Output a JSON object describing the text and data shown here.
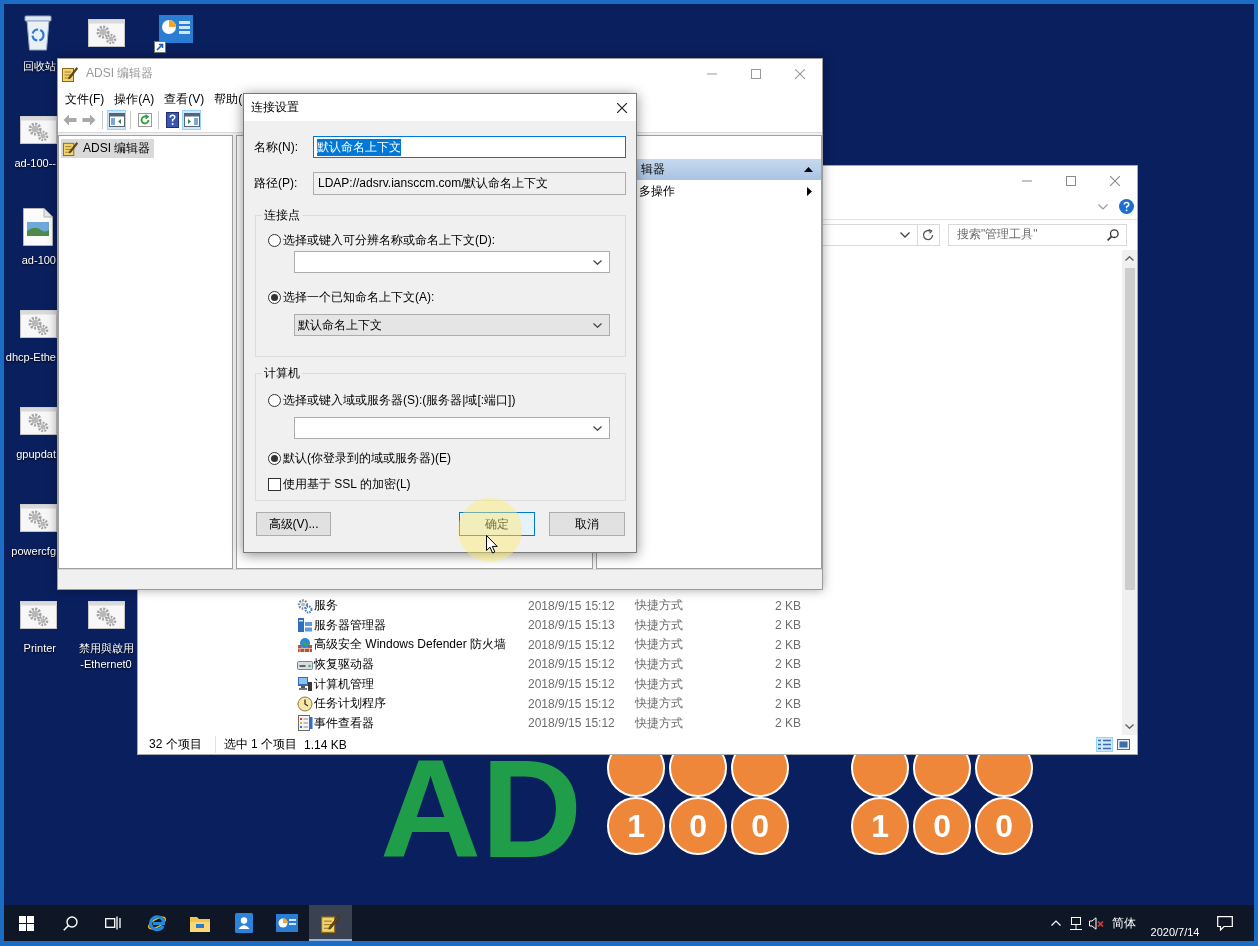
{
  "desktop_icons": [
    {
      "kind": "recycle-bin",
      "label": "回收站"
    },
    {
      "kind": "script"
    },
    {
      "kind": "dashboard-shortcut"
    },
    {
      "kind": "script",
      "label": "ad-100--"
    },
    {
      "kind": "image-file",
      "label": "ad-100"
    },
    {
      "kind": "script",
      "label": "dhcp-Ethe"
    },
    {
      "kind": "script",
      "label": "gpupdat"
    },
    {
      "kind": "script",
      "label": "powercfg"
    },
    {
      "kind": "script",
      "label": "Printer"
    },
    {
      "kind": "script",
      "label": "禁用與啟用\n-Ethernet0"
    }
  ],
  "wallpaper": {
    "title": "AD",
    "digits": [
      [
        "1",
        "0",
        "0"
      ],
      [
        "1",
        "0",
        "0"
      ]
    ]
  },
  "explorer_window": {
    "search": {
      "placeholder": "搜索\"管理工具\""
    },
    "files": [
      {
        "kind": "services",
        "name": "服务",
        "date": "2018/9/15 15:12",
        "type": "快捷方式",
        "size": "2 KB"
      },
      {
        "kind": "server-manager",
        "name": "服务器管理器",
        "date": "2018/9/15 15:13",
        "type": "快捷方式",
        "size": "2 KB"
      },
      {
        "kind": "firewall",
        "name": "高级安全 Windows Defender 防火墙",
        "date": "2018/9/15 15:12",
        "type": "快捷方式",
        "size": "2 KB"
      },
      {
        "kind": "recovery-drive",
        "name": "恢复驱动器",
        "date": "2018/9/15 15:12",
        "type": "快捷方式",
        "size": "2 KB"
      },
      {
        "kind": "computer-management",
        "name": "计算机管理",
        "date": "2018/9/15 15:12",
        "type": "快捷方式",
        "size": "2 KB"
      },
      {
        "kind": "task-scheduler",
        "name": "任务计划程序",
        "date": "2018/9/15 15:12",
        "type": "快捷方式",
        "size": "2 KB"
      },
      {
        "kind": "event-viewer",
        "name": "事件查看器",
        "date": "2018/9/15 15:12",
        "type": "快捷方式",
        "size": "2 KB"
      }
    ],
    "status": [
      "32 个项目",
      "选中 1 个项目",
      "1.14 KB"
    ],
    "views": [
      {
        "kind": "details",
        "selected": true
      },
      {
        "kind": "large-icons",
        "selected": false
      }
    ]
  },
  "adsi_window": {
    "title": "ADSI 编辑器",
    "menu": [
      "文件(F)",
      "操作(A)",
      "查看(V)",
      "帮助("
    ],
    "toolbar": [
      {
        "kind": "back",
        "disabled": true,
        "pressed": false
      },
      {
        "kind": "forward",
        "disabled": true,
        "pressed": false
      },
      {
        "kind": "tree",
        "disabled": false,
        "pressed": true
      },
      {
        "kind": "refresh",
        "disabled": false,
        "pressed": false
      },
      {
        "kind": "help",
        "disabled": false,
        "pressed": false
      },
      {
        "kind": "actions",
        "disabled": false,
        "pressed": true
      }
    ],
    "tree": [
      {
        "label": "ADSI 编辑器",
        "selected": true
      }
    ],
    "actions": {
      "header": "辑器",
      "items": [
        "多操作"
      ]
    }
  },
  "dialog": {
    "title": "连接设置",
    "fields": [
      {
        "label": "名称(N):",
        "value": "默认命名上下文",
        "readonly": false,
        "selected": true
      },
      {
        "label": "路径(P):",
        "value": "LDAP://adsrv.iansccm.com/默认命名上下文",
        "readonly": true,
        "selected": false
      }
    ],
    "groups": [
      {
        "title": "连接点",
        "controls": [
          {
            "kind": "radio",
            "label": "选择或键入可分辨名称或命名上下文(D):",
            "selected": false
          },
          {
            "kind": "combo"
          },
          {
            "kind": "radio",
            "label": "选择一个已知命名上下文(A):",
            "selected": true
          },
          {
            "kind": "dropdown",
            "value": "默认命名上下文"
          }
        ]
      },
      {
        "title": "计算机",
        "controls": [
          {
            "kind": "radio",
            "label": "选择或键入域或服务器(S):(服务器|域[:端口])",
            "selected": false
          },
          {
            "kind": "combo"
          },
          {
            "kind": "radio",
            "label": "默认(你登录到的域或服务器)(E)",
            "selected": true
          },
          {
            "kind": "checkbox",
            "label": "使用基于 SSL 的加密(L)",
            "checked": false
          }
        ]
      }
    ],
    "buttons": [
      {
        "label": "高级(V)...",
        "default": false
      },
      {
        "label": "确定",
        "default": true
      },
      {
        "label": "取消",
        "default": false
      }
    ]
  },
  "taskbar": {
    "apps": [
      {
        "kind": "start",
        "selected": false
      },
      {
        "kind": "search",
        "selected": false
      },
      {
        "kind": "task-view",
        "selected": false
      },
      {
        "kind": "browser",
        "selected": false
      },
      {
        "kind": "file-explorer",
        "selected": false
      },
      {
        "kind": "contacts",
        "selected": false
      },
      {
        "kind": "dashboard",
        "selected": false
      },
      {
        "kind": "adsi",
        "selected": true
      }
    ],
    "tray": {
      "muted": true,
      "ime": "简体",
      "date": "2020/7/14"
    }
  }
}
